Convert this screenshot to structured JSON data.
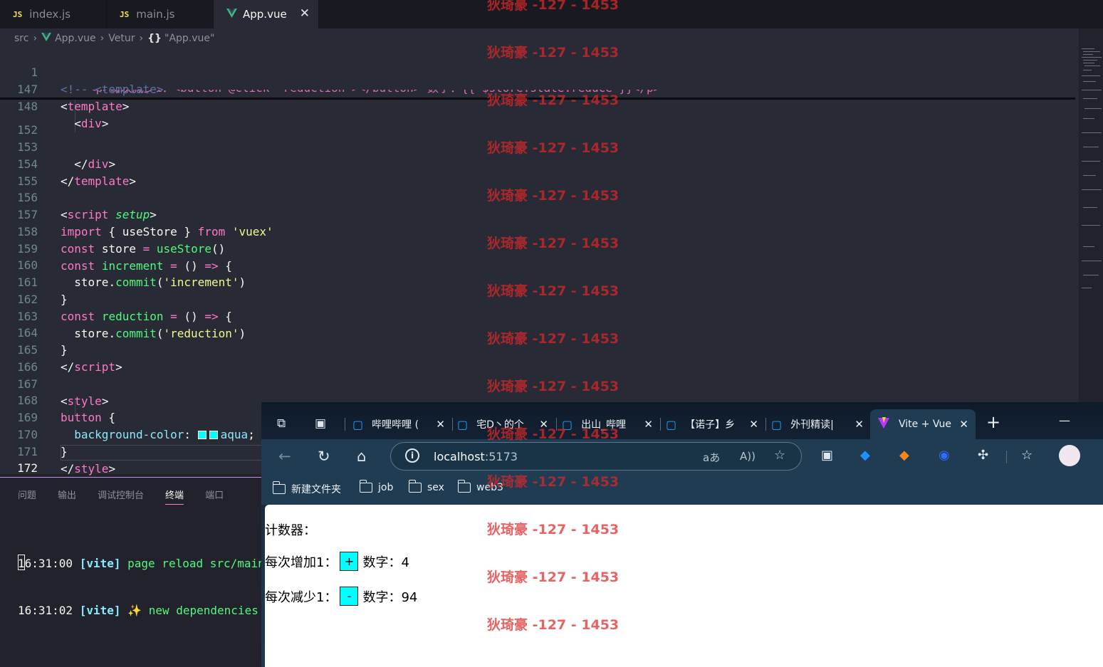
{
  "editor": {
    "tabs": [
      {
        "icon": "JS",
        "label": "index.js"
      },
      {
        "icon": "JS",
        "label": "main.js"
      },
      {
        "icon": "V",
        "label": "App.vue",
        "close": "✕"
      }
    ],
    "breadcrumb": {
      "src": "src",
      "file": "App.vue",
      "vetur": "Vetur",
      "braces": "{}",
      "symbol": "\"App.vue\""
    },
    "line_numbers": [
      "1",
      "147",
      "148",
      "152",
      "153",
      "154",
      "155",
      "156",
      "157",
      "158",
      "159",
      "160",
      "161",
      "162",
      "163",
      "164",
      "165",
      "166",
      "167",
      "168",
      "169",
      "170",
      "171",
      "172"
    ],
    "sticky_hidden_text": "<p>每次减少1：<button @click=\"reduction\"></button> 数字：{{ $store.state.reduce }}</p>"
  },
  "panel": {
    "tabs": [
      "问题",
      "输出",
      "调试控制台",
      "终端",
      "端口"
    ],
    "active_tab": "终端",
    "terminal": [
      {
        "time": "16:31:00",
        "tag": "[vite]",
        "msg": "page reload src/main.j"
      },
      {
        "time": "16:31:02",
        "tag": "[vite]",
        "icon": "✨",
        "msg": "new dependencies op"
      }
    ]
  },
  "browser": {
    "tabs": [
      {
        "label": "哔哩哔哩 ("
      },
      {
        "label": "宅D丶的个"
      },
      {
        "label": "出山_哔哩"
      },
      {
        "label": "【诺子】乡"
      },
      {
        "label": "外刊精读|"
      },
      {
        "label": "Vite + Vue",
        "active": true
      }
    ],
    "close_glyph": "✕",
    "new_tab": "+",
    "minimize": "—",
    "url_host": "localhost",
    "url_port": ":5173",
    "bookmarks": [
      "新建文件夹",
      "job",
      "sex",
      "web3"
    ],
    "page": {
      "title": "计数器：",
      "inc_label": "每次增加1：",
      "inc_button": "+",
      "inc_value_label": "数字：4",
      "dec_label": "每次减少1：",
      "dec_button": "-",
      "dec_value_label": "数字：94"
    }
  },
  "watermark": "狄琦豪 -127 - 1453",
  "colors": {
    "accent_tab_border": "#ff79c6",
    "button_bg": "#00ffff",
    "panel_border": "#bd93f9"
  }
}
